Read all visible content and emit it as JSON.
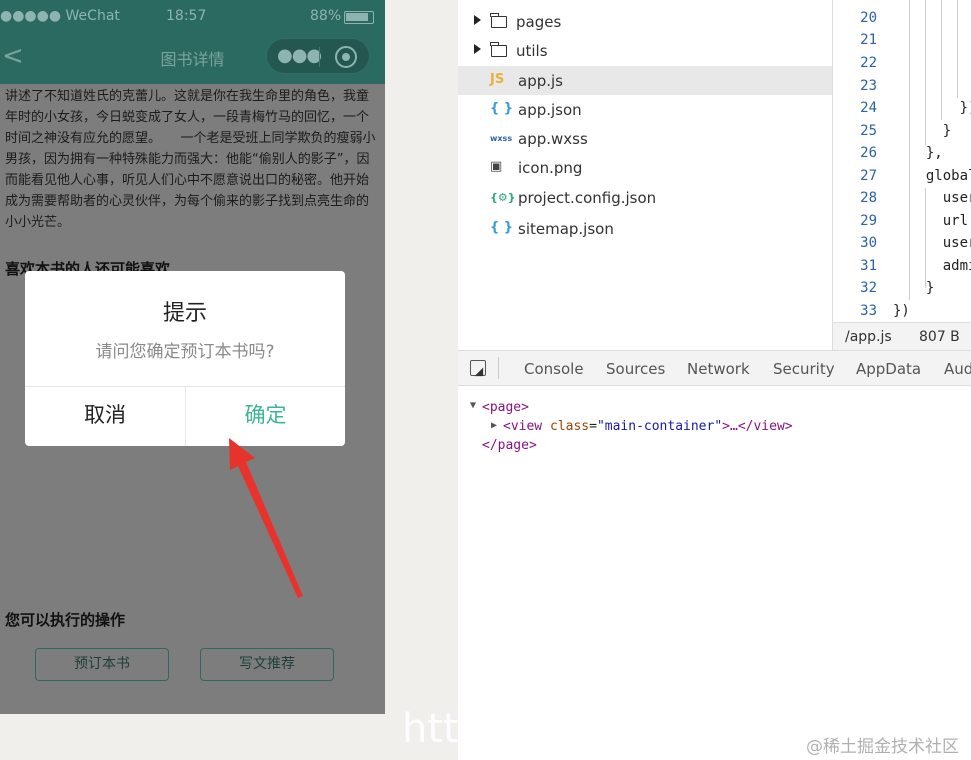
{
  "phone": {
    "status_bar": {
      "signal": "●●●●● WeChat",
      "time": "18:57",
      "battery": "88%"
    },
    "nav_title": "图书详情",
    "description": "讲述了不知道姓氏的克蕾儿。这就是你在我生命里的角色，我童年时的小女孩，今日蜕变成了女人，一段青梅竹马的回忆，一个时间之神没有应允的愿望。　　一个老是受班上同学欺负的瘦弱小男孩，因为拥有一种特殊能力而强大：他能“偷别人的影子”，因而能看见他人心事，听见人们心中不愿意说出口的秘密。他开始成为需要帮助者的心灵伙伴，为每个偷来的影子找到点亮生命的小小光芒。",
    "section_like": "喜欢本书的人还可能喜欢",
    "section_actions": "您可以执行的操作",
    "btn_reserve": "预订本书",
    "btn_review": "写文推荐"
  },
  "dialog": {
    "title": "提示",
    "message": "请问您确定预订本书吗?",
    "cancel": "取消",
    "confirm": "确定"
  },
  "file_tree": {
    "items": [
      {
        "label": "pages",
        "type": "folder"
      },
      {
        "label": "utils",
        "type": "folder"
      },
      {
        "label": "app.js",
        "type": "js",
        "icon": "JS",
        "selected": true
      },
      {
        "label": "app.json",
        "type": "json",
        "icon": "{ }"
      },
      {
        "label": "app.wxss",
        "type": "wxss",
        "icon": "wxss"
      },
      {
        "label": "icon.png",
        "type": "image",
        "icon": "▣"
      },
      {
        "label": "project.config.json",
        "type": "config",
        "icon": "{⚙}"
      },
      {
        "label": "sitemap.json",
        "type": "json",
        "icon": "{ }"
      }
    ]
  },
  "editor": {
    "lines": [
      {
        "n": "20",
        "t": ""
      },
      {
        "n": "21",
        "t": ""
      },
      {
        "n": "22",
        "t": ""
      },
      {
        "n": "23",
        "t": ""
      },
      {
        "n": "24",
        "t": "      })"
      },
      {
        "n": "25",
        "t": "    }"
      },
      {
        "n": "26",
        "t": "  },"
      },
      {
        "n": "27",
        "t": "  global"
      },
      {
        "n": "28",
        "t": "    user"
      },
      {
        "n": "29",
        "t": "    url:"
      },
      {
        "n": "30",
        "t": "    user"
      },
      {
        "n": "31",
        "t": "    admi"
      },
      {
        "n": "32",
        "t": "  }"
      },
      {
        "n": "33",
        "t": "})"
      }
    ],
    "status_file": "/app.js",
    "status_size": "807 B"
  },
  "devtools": {
    "tabs": [
      "Console",
      "Sources",
      "Network",
      "Security",
      "AppData",
      "Aud"
    ],
    "dom": {
      "page_open": "<page>",
      "view_tag": "<view",
      "view_attr": "class",
      "view_val": "\"main-container\"",
      "view_rest": ">…</view>",
      "page_close": "</page>"
    }
  },
  "watermark": {
    "left": "http",
    "right": "@稀土掘金技术社区"
  },
  "colors": {
    "brand": "#2b6a61",
    "confirm": "#3cb39a",
    "arrow": "#e8332d"
  }
}
